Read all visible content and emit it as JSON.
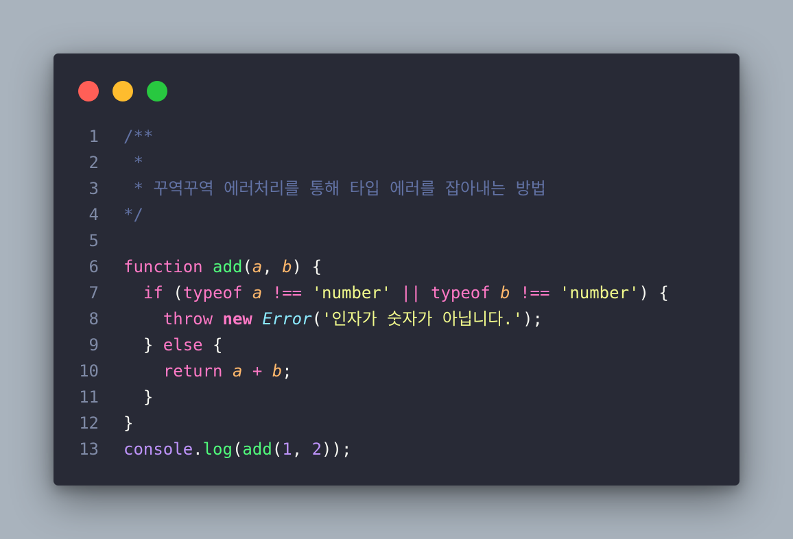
{
  "window": {
    "buttons": [
      {
        "name": "close",
        "color": "#ff5f57"
      },
      {
        "name": "minimize",
        "color": "#febc2e"
      },
      {
        "name": "zoom",
        "color": "#28c840"
      }
    ]
  },
  "code": {
    "lines": [
      {
        "number": "1",
        "tokens": [
          {
            "t": "/**",
            "c": "comment"
          }
        ]
      },
      {
        "number": "2",
        "tokens": [
          {
            "t": " *",
            "c": "comment"
          }
        ]
      },
      {
        "number": "3",
        "tokens": [
          {
            "t": " * 꾸역꾸역 에러처리를 통해 타입 에러를 잡아내는 방법",
            "c": "comment"
          }
        ]
      },
      {
        "number": "4",
        "tokens": [
          {
            "t": "*/",
            "c": "comment"
          }
        ]
      },
      {
        "number": "5",
        "tokens": []
      },
      {
        "number": "6",
        "tokens": [
          {
            "t": "function",
            "c": "kw"
          },
          {
            "t": " ",
            "c": "punc"
          },
          {
            "t": "add",
            "c": "fn"
          },
          {
            "t": "(",
            "c": "punc"
          },
          {
            "t": "a",
            "c": "param"
          },
          {
            "t": ", ",
            "c": "punc"
          },
          {
            "t": "b",
            "c": "param"
          },
          {
            "t": ") {",
            "c": "punc"
          }
        ]
      },
      {
        "number": "7",
        "tokens": [
          {
            "t": "  ",
            "c": "punc"
          },
          {
            "t": "if",
            "c": "kw"
          },
          {
            "t": " (",
            "c": "punc"
          },
          {
            "t": "typeof",
            "c": "kw"
          },
          {
            "t": " ",
            "c": "punc"
          },
          {
            "t": "a",
            "c": "param"
          },
          {
            "t": " ",
            "c": "punc"
          },
          {
            "t": "!==",
            "c": "kw"
          },
          {
            "t": " ",
            "c": "punc"
          },
          {
            "t": "'number'",
            "c": "str"
          },
          {
            "t": " ",
            "c": "punc"
          },
          {
            "t": "||",
            "c": "kw"
          },
          {
            "t": " ",
            "c": "punc"
          },
          {
            "t": "typeof",
            "c": "kw"
          },
          {
            "t": " ",
            "c": "punc"
          },
          {
            "t": "b",
            "c": "param"
          },
          {
            "t": " ",
            "c": "punc"
          },
          {
            "t": "!==",
            "c": "kw"
          },
          {
            "t": " ",
            "c": "punc"
          },
          {
            "t": "'number'",
            "c": "str"
          },
          {
            "t": ") {",
            "c": "punc"
          }
        ]
      },
      {
        "number": "8",
        "tokens": [
          {
            "t": "    ",
            "c": "punc"
          },
          {
            "t": "throw",
            "c": "kw"
          },
          {
            "t": " ",
            "c": "punc"
          },
          {
            "t": "new",
            "c": "kwb"
          },
          {
            "t": " ",
            "c": "punc"
          },
          {
            "t": "Error",
            "c": "class"
          },
          {
            "t": "(",
            "c": "punc"
          },
          {
            "t": "'인자가 숫자가 아닙니다.'",
            "c": "str"
          },
          {
            "t": ");",
            "c": "punc"
          }
        ]
      },
      {
        "number": "9",
        "tokens": [
          {
            "t": "  } ",
            "c": "punc"
          },
          {
            "t": "else",
            "c": "kw"
          },
          {
            "t": " {",
            "c": "punc"
          }
        ]
      },
      {
        "number": "10",
        "tokens": [
          {
            "t": "    ",
            "c": "punc"
          },
          {
            "t": "return",
            "c": "kw"
          },
          {
            "t": " ",
            "c": "punc"
          },
          {
            "t": "a",
            "c": "param"
          },
          {
            "t": " ",
            "c": "punc"
          },
          {
            "t": "+",
            "c": "kw"
          },
          {
            "t": " ",
            "c": "punc"
          },
          {
            "t": "b",
            "c": "param"
          },
          {
            "t": ";",
            "c": "punc"
          }
        ]
      },
      {
        "number": "11",
        "tokens": [
          {
            "t": "  }",
            "c": "punc"
          }
        ]
      },
      {
        "number": "12",
        "tokens": [
          {
            "t": "}",
            "c": "punc"
          }
        ]
      },
      {
        "number": "13",
        "tokens": [
          {
            "t": "console",
            "c": "obj"
          },
          {
            "t": ".",
            "c": "punc"
          },
          {
            "t": "log",
            "c": "fn"
          },
          {
            "t": "(",
            "c": "punc"
          },
          {
            "t": "add",
            "c": "fn"
          },
          {
            "t": "(",
            "c": "punc"
          },
          {
            "t": "1",
            "c": "num"
          },
          {
            "t": ", ",
            "c": "punc"
          },
          {
            "t": "2",
            "c": "num"
          },
          {
            "t": "));",
            "c": "punc"
          }
        ]
      }
    ]
  }
}
